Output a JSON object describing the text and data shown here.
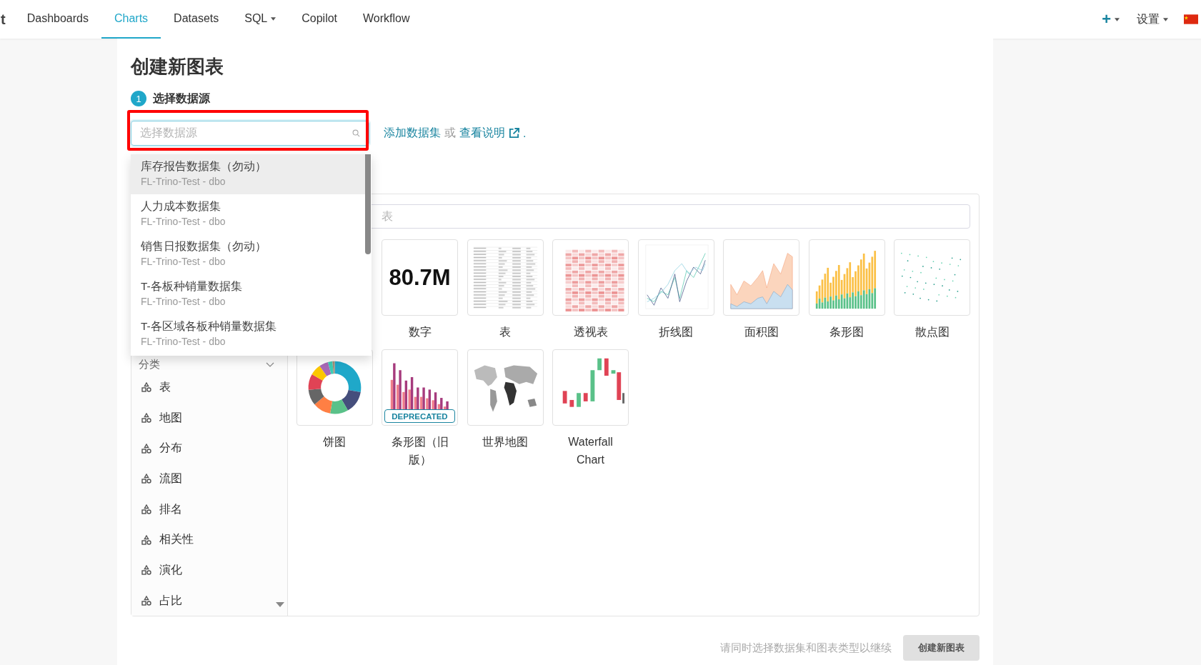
{
  "nav": {
    "logo": "t",
    "tabs": [
      {
        "label": "Dashboards",
        "selected": false,
        "has_menu": false
      },
      {
        "label": "Charts",
        "selected": true,
        "has_menu": false
      },
      {
        "label": "Datasets",
        "selected": false,
        "has_menu": false
      },
      {
        "label": "SQL",
        "selected": false,
        "has_menu": true
      },
      {
        "label": "Copilot",
        "selected": false,
        "has_menu": false
      },
      {
        "label": "Workflow",
        "selected": false,
        "has_menu": false
      }
    ],
    "add_label": "+",
    "settings_label": "设置"
  },
  "title": "创建新图表",
  "step1": {
    "number": "1",
    "title": "选择数据源",
    "select_placeholder": "选择数据源",
    "link_add": "添加数据集",
    "or": "或",
    "link_docs": "查看说明",
    "period": "."
  },
  "dropdown": {
    "options": [
      {
        "name": "库存报告数据集（勿动）",
        "source": "FL-Trino-Test - dbo",
        "selected": true
      },
      {
        "name": "人力成本数据集",
        "source": "FL-Trino-Test - dbo",
        "selected": false
      },
      {
        "name": "销售日报数据集（勿动）",
        "source": "FL-Trino-Test - dbo",
        "selected": false
      },
      {
        "name": "T-各板种销量数据集",
        "source": "FL-Trino-Test - dbo",
        "selected": false
      },
      {
        "name": "T-各区域各板种销量数据集",
        "source": "FL-Trino-Test - dbo",
        "selected": false
      }
    ]
  },
  "chart_picker": {
    "search_placeholder": "表",
    "category_header": "分类",
    "categories": [
      "表",
      "地图",
      "分布",
      "流图",
      "排名",
      "相关性",
      "演化",
      "占比"
    ],
    "chart_types": [
      {
        "kind": "number",
        "label": "数字",
        "value": "80.7M"
      },
      {
        "kind": "table",
        "label": "表"
      },
      {
        "kind": "pivot",
        "label": "透视表"
      },
      {
        "kind": "line",
        "label": "折线图"
      },
      {
        "kind": "area",
        "label": "面积图"
      },
      {
        "kind": "bar",
        "label": "条形图"
      },
      {
        "kind": "scatter",
        "label": "散点图"
      },
      {
        "kind": "donut",
        "label": "饼图"
      },
      {
        "kind": "legacy_bar",
        "label": "条形图（旧版）",
        "badge": "DEPRECATED"
      },
      {
        "kind": "map",
        "label": "世界地图"
      },
      {
        "kind": "waterfall",
        "label": "Waterfall Chart"
      }
    ]
  },
  "footer": {
    "hint": "请同时选择数据集和图表类型以继续",
    "button": "创建新图表"
  }
}
